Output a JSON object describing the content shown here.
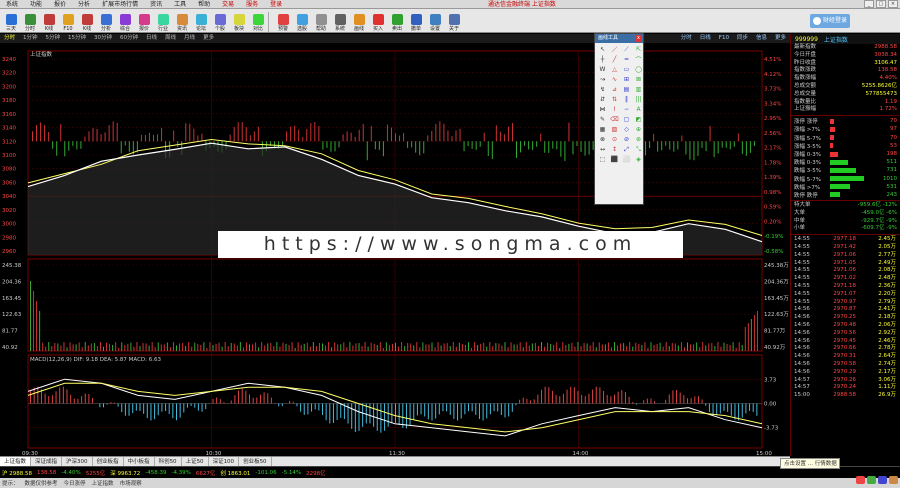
{
  "menu": {
    "items": [
      "系统",
      "功能",
      "报价",
      "分析",
      "扩展市场行情",
      "资讯",
      "工具",
      "帮助"
    ],
    "highlighted": [
      "交易",
      "服务",
      "登录"
    ],
    "center_title": "通达信金融终端 上证指数"
  },
  "toolbar": {
    "buttons": [
      {
        "label": "三天",
        "icon": "#2a6fd6"
      },
      {
        "label": "分时",
        "icon": "#3a8f3a"
      },
      {
        "label": "K线",
        "icon": "#c03a3a"
      },
      {
        "label": "F10",
        "icon": "#e0a020"
      },
      {
        "label": "K线",
        "icon": "#c03a3a"
      },
      {
        "label": "分析",
        "icon": "#3a6fd6"
      },
      {
        "label": "综合",
        "icon": "#8a3ad6"
      },
      {
        "label": "报价",
        "icon": "#d63a8a"
      },
      {
        "label": "行业",
        "icon": "#3ad6a0"
      },
      {
        "label": "资讯",
        "icon": "#d68a3a"
      },
      {
        "label": "论坛",
        "icon": "#3ab0d6"
      },
      {
        "label": "个股",
        "icon": "#6a6ad6"
      },
      {
        "label": "板块",
        "icon": "#d6d63a"
      },
      {
        "label": "对比",
        "icon": "#3ad63a"
      }
    ],
    "buttons2": [
      {
        "label": "预警",
        "icon": "#e04040"
      },
      {
        "label": "选股",
        "icon": "#40a0e0"
      },
      {
        "label": "帮助",
        "icon": "#909090"
      },
      {
        "label": "系统",
        "icon": "#606060"
      },
      {
        "label": "画线",
        "icon": "#e09020"
      },
      {
        "label": "买入",
        "icon": "#e03030"
      },
      {
        "label": "卖出",
        "icon": "#30a030"
      },
      {
        "label": "撤单",
        "icon": "#3060c0"
      },
      {
        "label": "设置",
        "icon": "#4080c0"
      },
      {
        "label": "关于",
        "icon": "#5070b0"
      }
    ],
    "login_label": "财经登录"
  },
  "period_tabs": [
    "分时",
    "1分钟",
    "5分钟",
    "15分钟",
    "30分钟",
    "60分钟",
    "日线",
    "周线",
    "月线",
    "更多"
  ],
  "period_tabs_right": [
    "分时",
    "日线",
    "F10",
    "同步",
    "信息",
    "更多"
  ],
  "chart_data": [
    {
      "type": "line",
      "title": "上证指数",
      "series": [
        {
          "name": "均线",
          "values": [
            3040,
            3055,
            3070,
            3092,
            3101,
            3110,
            3103,
            3100,
            3087,
            3060,
            3045,
            3022,
            3015,
            3002,
            2990,
            2975,
            2966,
            2968,
            2980,
            2973,
            2955
          ]
        },
        {
          "name": "指数",
          "values": [
            3034,
            3052,
            3075,
            3085,
            3094,
            3104,
            3095,
            3098,
            3078,
            3052,
            3038,
            3016,
            3008,
            2995,
            2985,
            2970,
            2958,
            2960,
            2974,
            2965,
            2945
          ]
        }
      ],
      "ylim": [
        2930,
        3240
      ],
      "yticks_left": [
        "3240",
        "3220",
        "3200",
        "3180",
        "3160",
        "3140",
        "3120",
        "3100",
        "3080",
        "3060",
        "3040",
        "3020",
        "3000",
        "2980",
        "2960"
      ],
      "yticks_right": [
        "4.51%",
        "4.12%",
        "3.73%",
        "3.34%",
        "2.95%",
        "2.56%",
        "2.17%",
        "1.78%",
        "1.39%",
        "0.98%",
        "0.59%",
        "0.20%",
        "-0.19%",
        "-0.58%"
      ]
    },
    {
      "type": "bar",
      "title": "成交量",
      "yticks_left": [
        "245.38",
        "204.36",
        "163.45",
        "122.63",
        "81.77",
        "40.92"
      ],
      "yticks_right": [
        "245.38万",
        "204.36万",
        "163.45万",
        "122.63万",
        "81.77万",
        "40.92万"
      ]
    },
    {
      "type": "line",
      "title": "MACD(12,26,9) DIF: 9.18 DEA: 5.87 MACD: 6.63",
      "series": [
        {
          "name": "DIF",
          "values": [
            3,
            6,
            5,
            2,
            1,
            3,
            5,
            4,
            2,
            -2,
            -5,
            -6,
            -7,
            -8,
            -5,
            -3,
            -1,
            -2,
            -1,
            -4,
            -6
          ]
        },
        {
          "name": "DEA",
          "values": [
            2,
            5,
            5,
            3,
            2,
            3,
            4,
            4,
            3,
            0,
            -3,
            -5,
            -6,
            -7,
            -6,
            -4,
            -2,
            -2,
            -2,
            -3,
            -5
          ]
        }
      ],
      "ylim": [
        -10,
        10
      ],
      "yticks": [
        "3.73",
        "0.00",
        "-3.73"
      ]
    }
  ],
  "x_time_labels": [
    "09:30",
    "10:30",
    "11:30",
    "14:00",
    "15:00"
  ],
  "right_panel": {
    "code": "999999",
    "name": "上证指数",
    "stats": [
      {
        "k": "最新指数",
        "v": "2988.58",
        "c": "r"
      },
      {
        "k": "今日开盘",
        "v": "3038.34",
        "c": "r"
      },
      {
        "k": "昨日收盘",
        "v": "3106.47",
        "c": "y"
      },
      {
        "k": "指数涨跌",
        "v": "138.58",
        "c": "r"
      },
      {
        "k": "指数涨幅",
        "v": "4.40%",
        "c": "r"
      },
      {
        "k": "总成交额",
        "v": "5255.8626亿",
        "c": "y"
      },
      {
        "k": "总成交量",
        "v": "577855473",
        "c": "y"
      },
      {
        "k": "指数量比",
        "v": "1.19",
        "c": "r"
      },
      {
        "k": "上证振幅",
        "v": "1.72%",
        "c": "r"
      }
    ],
    "bars_up": [
      {
        "k": "涨停 涨停",
        "v": "70",
        "w": 4
      },
      {
        "k": "涨幅 >7%",
        "v": "97",
        "w": 5
      },
      {
        "k": "涨幅 5-7%",
        "v": "70",
        "w": 4
      },
      {
        "k": "涨幅 3-5%",
        "v": "53",
        "w": 3
      },
      {
        "k": "涨幅 0-3%",
        "v": "198",
        "w": 8
      }
    ],
    "bars_down": [
      {
        "k": "跌幅 0-3%",
        "v": "511",
        "w": 18
      },
      {
        "k": "跌幅 3-5%",
        "v": "731",
        "w": 26
      },
      {
        "k": "跌幅 5-7%",
        "v": "1010",
        "w": 34
      },
      {
        "k": "跌幅 >7%",
        "v": "531",
        "w": 20
      },
      {
        "k": "跌停 跌停",
        "v": "243",
        "w": 10
      }
    ],
    "flows": [
      {
        "k": "特大单",
        "v": "-959.6亿 -12%"
      },
      {
        "k": "大单",
        "v": "-459.0亿 -6%"
      },
      {
        "k": "中单",
        "v": "-929.7亿 -9%"
      },
      {
        "k": "小单",
        "v": "-609.7亿 -9%"
      }
    ],
    "ticks": [
      {
        "t": "14:55",
        "p": "2977.18",
        "q": "2.45万"
      },
      {
        "t": "14:55",
        "p": "2971.42",
        "q": "2.05万"
      },
      {
        "t": "14:55",
        "p": "2971.06",
        "q": "2.77万"
      },
      {
        "t": "14:55",
        "p": "2971.05",
        "q": "2.49万"
      },
      {
        "t": "14:55",
        "p": "2971.06",
        "q": "2.08万"
      },
      {
        "t": "14:55",
        "p": "2971.02",
        "q": "2.48万"
      },
      {
        "t": "14:55",
        "p": "2971.18",
        "q": "2.36万"
      },
      {
        "t": "14:55",
        "p": "2971.07",
        "q": "2.20万"
      },
      {
        "t": "14:55",
        "p": "2970.97",
        "q": "2.79万"
      },
      {
        "t": "14:56",
        "p": "2970.87",
        "q": "2.41万"
      },
      {
        "t": "14:56",
        "p": "2970.25",
        "q": "2.18万"
      },
      {
        "t": "14:56",
        "p": "2970.48",
        "q": "2.06万"
      },
      {
        "t": "14:56",
        "p": "2970.56",
        "q": "2.92万"
      },
      {
        "t": "14:56",
        "p": "2970.45",
        "q": "2.46万"
      },
      {
        "t": "14:56",
        "p": "2970.66",
        "q": "2.78万"
      },
      {
        "t": "14:56",
        "p": "2970.31",
        "q": "2.64万"
      },
      {
        "t": "14:56",
        "p": "2970.58",
        "q": "2.74万"
      },
      {
        "t": "14:56",
        "p": "2970.29",
        "q": "2.17万"
      },
      {
        "t": "14:57",
        "p": "2970.26",
        "q": "3.06万"
      },
      {
        "t": "14:57",
        "p": "2970.24",
        "q": "1.11万"
      },
      {
        "t": "15:00",
        "p": "2988.58",
        "q": "26.9万"
      }
    ]
  },
  "palette": {
    "title": "画线工具",
    "close": "x"
  },
  "watermark": "https://www.songma.com",
  "bottom_tabs": [
    "上证指数",
    "深证成指",
    "沪深300",
    "创业板指",
    "中小板指",
    "科创50",
    "上证50",
    "深证100",
    "创业板50"
  ],
  "status": {
    "line1": [
      "沪 2988.58",
      "138.58",
      "-4.40%",
      "5255亿",
      "深 9963.72",
      "-458.39",
      "-4.39%",
      "6627亿",
      "创 1863.01",
      "-101.06",
      "-5.14%",
      "2298亿"
    ],
    "line2": [
      "提示：",
      "数据仅供参考",
      "今日涨停",
      "上证指数",
      "市场观察"
    ]
  },
  "tooltip": "点击设置 ... 行情数据"
}
